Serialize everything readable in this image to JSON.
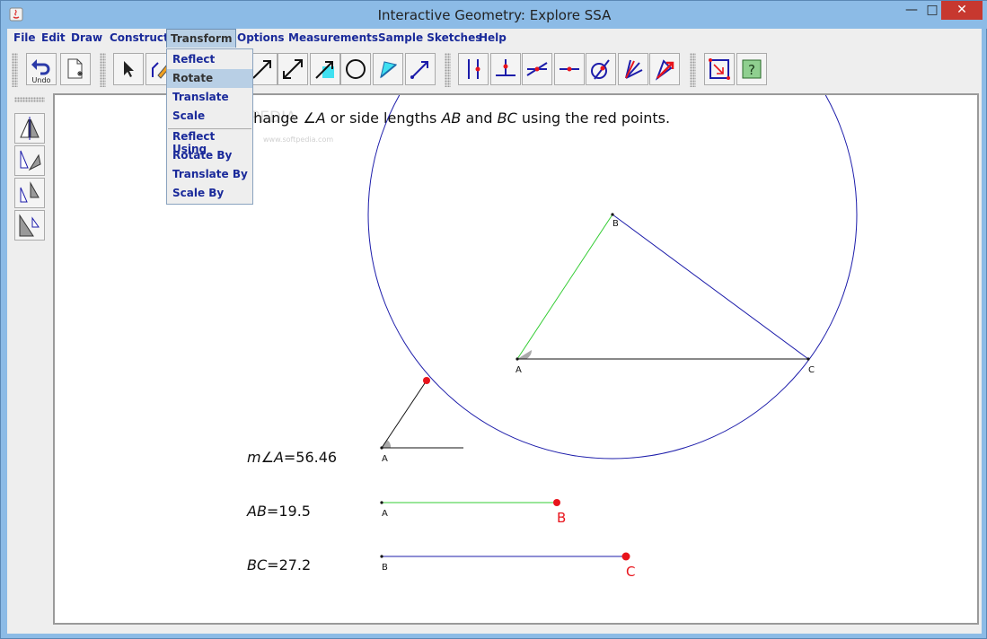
{
  "window": {
    "title": "Interactive Geometry: Explore SSA",
    "min": "—",
    "max": "□",
    "close": "✕"
  },
  "menubar": [
    "File",
    "Edit",
    "Draw",
    "Construct",
    "Transform",
    "Options",
    "Measurements",
    "Sample Sketches",
    "Help"
  ],
  "toolbar": {
    "undo_label": "Undo"
  },
  "transform_menu": {
    "items": [
      "Reflect",
      "Rotate",
      "Translate",
      "Scale"
    ],
    "by_items": [
      "Reflect Using",
      "Rotate By",
      "Translate By",
      "Scale By"
    ],
    "selected": "Rotate"
  },
  "canvas": {
    "instruction": {
      "prefix": "Change ",
      "angle_symbol": "∠",
      "angle_var": "A",
      "mid": " or side lengths ",
      "seg1": "AB",
      "and": " and ",
      "seg2": "BC",
      "suffix": " using the red points."
    },
    "watermark": "SOFTPEDIA",
    "watermark_url": "www.softpedia.com",
    "triangle_labels": {
      "a": "A",
      "b": "B",
      "c": "C"
    },
    "measurements": {
      "angle": {
        "m": "m",
        "symbol": "∠",
        "var": "A",
        "eq": "=56.46",
        "value": 56.46
      },
      "ab": {
        "label": "AB",
        "eq": "=19.5",
        "value": 19.5
      },
      "bc": {
        "label": "BC",
        "eq": "=27.2",
        "value": 27.2
      }
    },
    "control_labels": {
      "angle_vertex": "A",
      "ab_start": "A",
      "ab_end": "B",
      "bc_start": "B",
      "bc_end": "C"
    }
  },
  "colors": {
    "red": "#e8141c",
    "green": "#33cc33",
    "blue": "#1c1caa",
    "menu_text": "#1a2a9a"
  }
}
